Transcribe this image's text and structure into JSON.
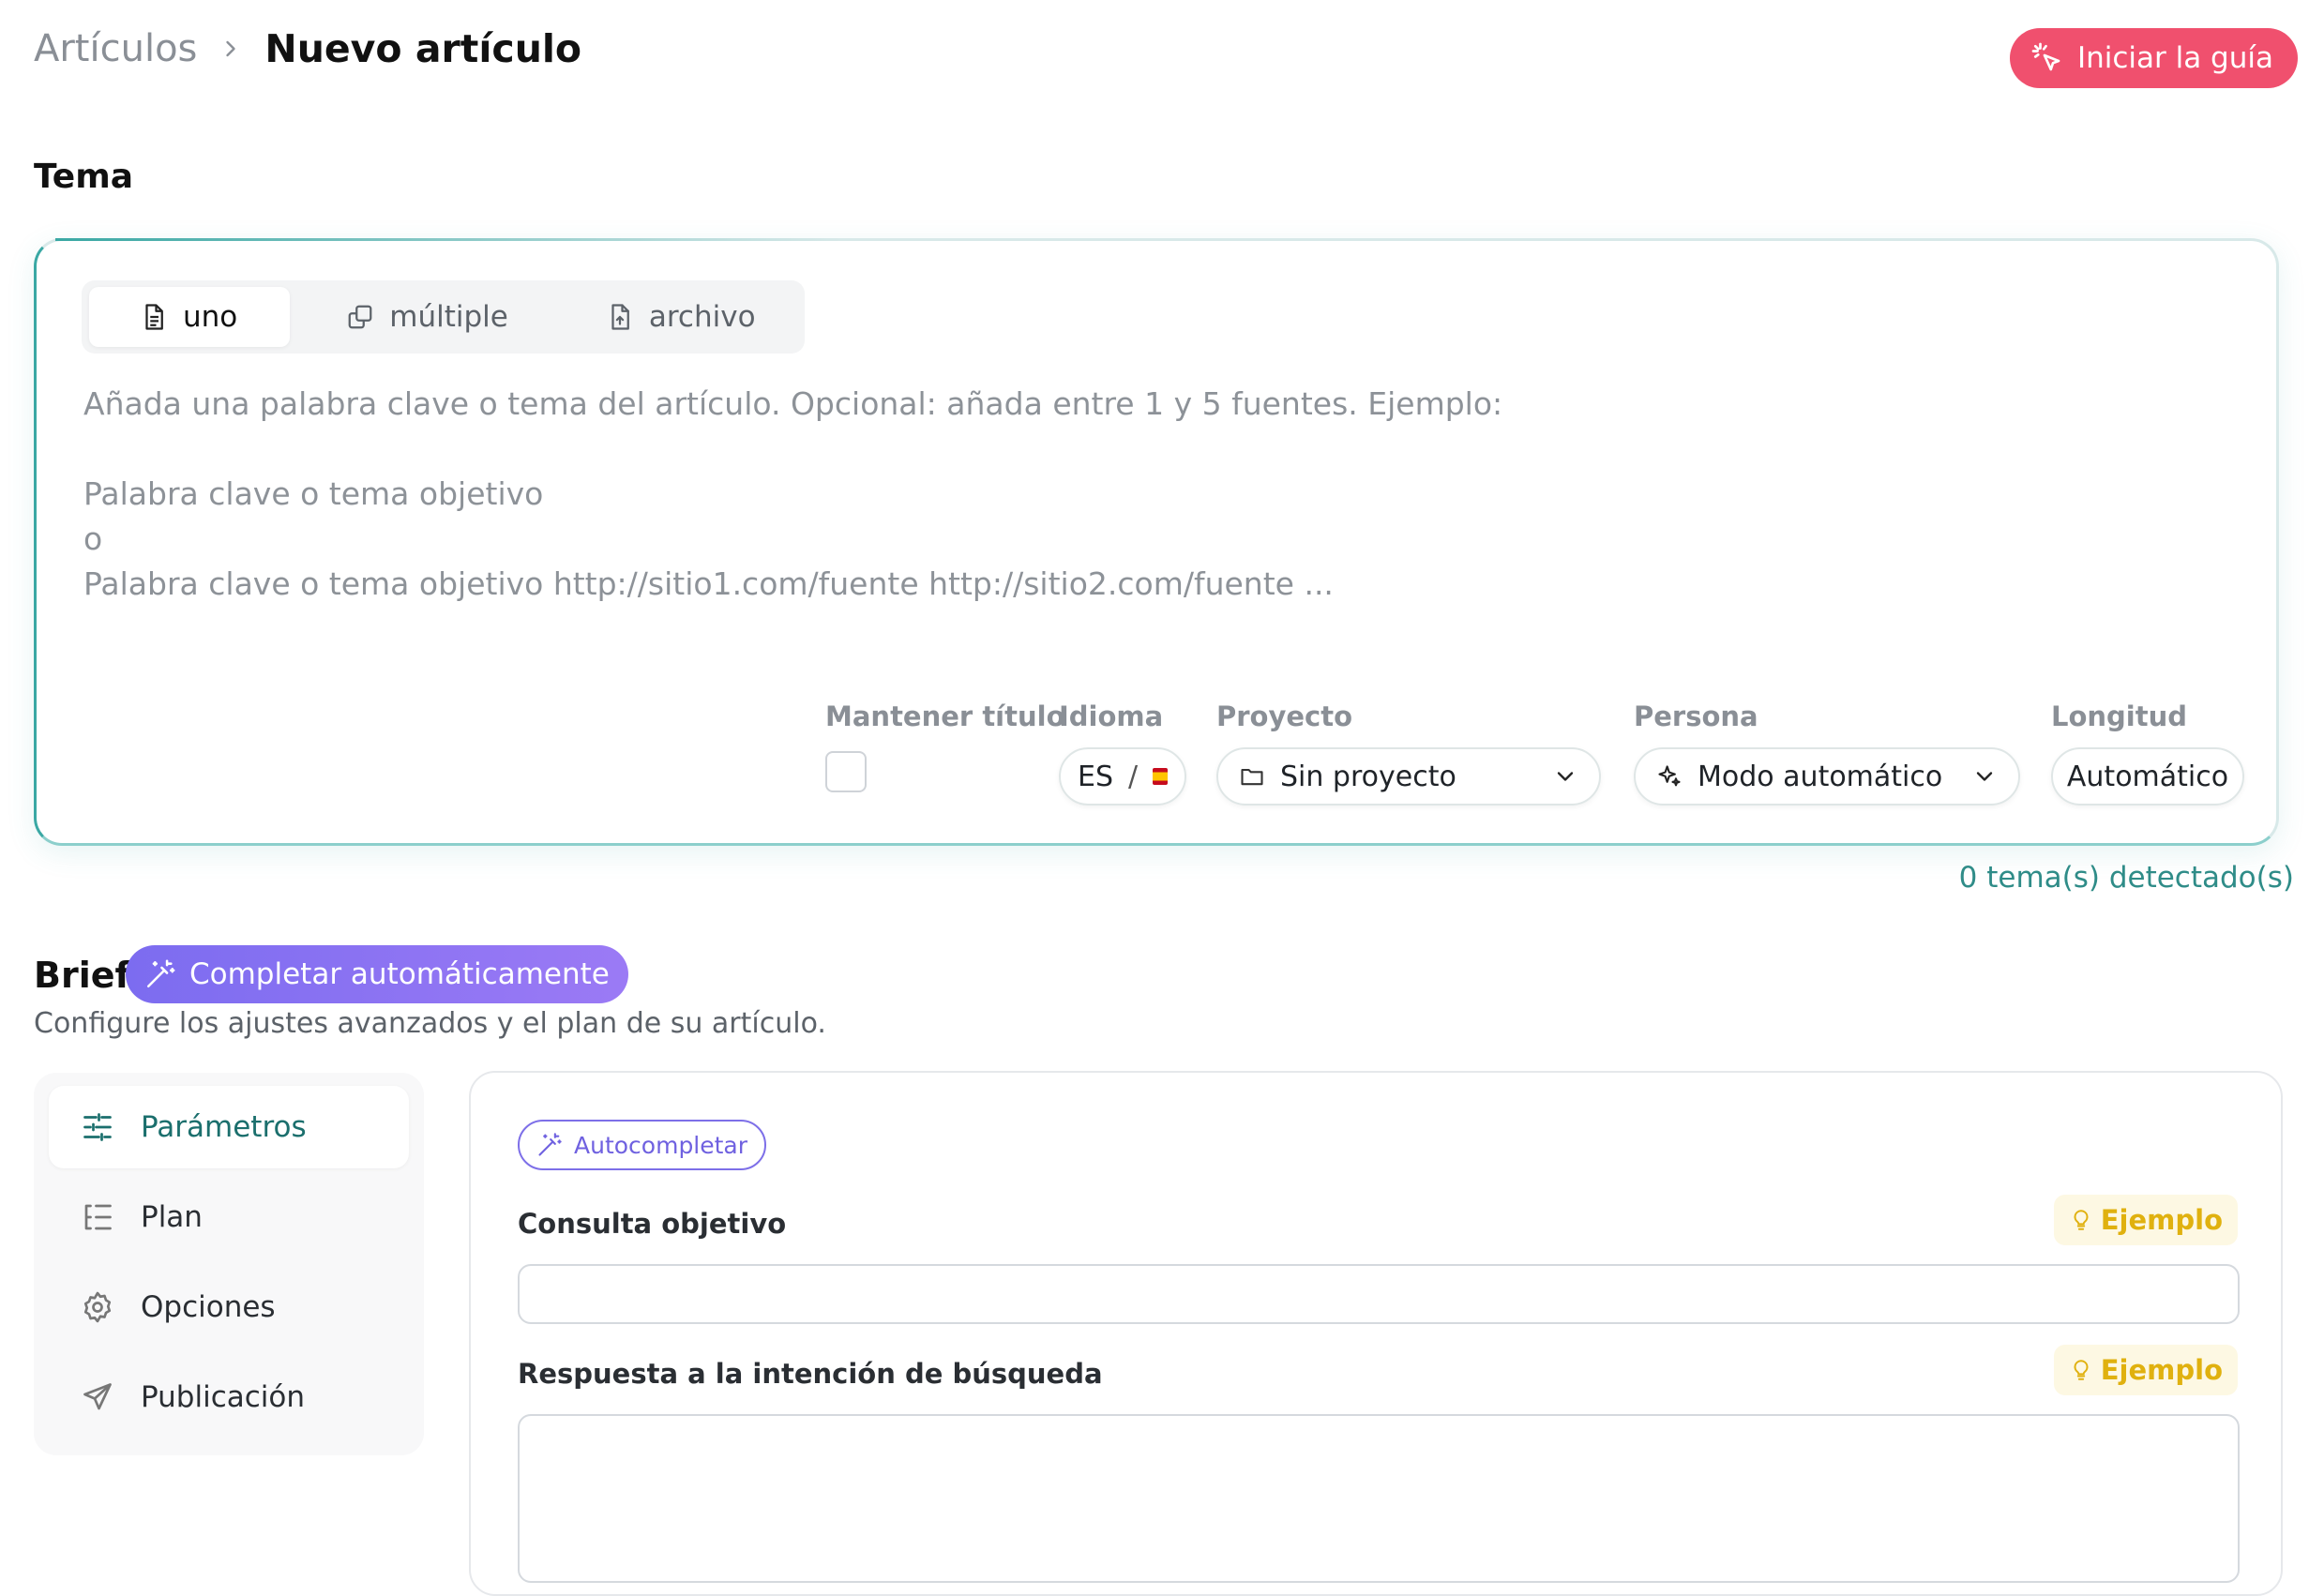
{
  "breadcrumb": {
    "parent": "Artículos",
    "current": "Nuevo artículo"
  },
  "guide_button": {
    "label": "Iniciar la guía"
  },
  "tema": {
    "title": "Tema",
    "tabs": [
      {
        "label": "uno",
        "icon": "file-text-icon",
        "active": true
      },
      {
        "label": "múltiple",
        "icon": "copy-icon",
        "active": false
      },
      {
        "label": "archivo",
        "icon": "file-upload-icon",
        "active": false
      }
    ],
    "placeholder": "Añada una palabra clave o tema del artículo. Opcional: añada entre 1 y 5 fuentes. Ejemplo:\n\nPalabra clave o tema objetivo\no\nPalabra clave o tema objetivo http://sitio1.com/fuente http://sitio2.com/fuente ...",
    "fields": {
      "keep_title_label": "Mantener título",
      "language_label": "Idioma",
      "language_code": "ES",
      "language_sep": "/",
      "project_label": "Proyecto",
      "project_value": "Sin proyecto",
      "persona_label": "Persona",
      "persona_value": "Modo automático",
      "length_label": "Longitud",
      "length_value": "Automático"
    },
    "detected": "0 tema(s) detectado(s)"
  },
  "brief": {
    "title": "Brief",
    "autofill_label": "Completar automáticamente",
    "subtitle": "Configure los ajustes avanzados y el plan de su artículo.",
    "nav": [
      {
        "label": "Parámetros",
        "icon": "sliders-icon",
        "active": true
      },
      {
        "label": "Plan",
        "icon": "outline-list-icon",
        "active": false
      },
      {
        "label": "Opciones",
        "icon": "gear-icon",
        "active": false
      },
      {
        "label": "Publicación",
        "icon": "send-icon",
        "active": false
      }
    ],
    "form": {
      "autocomplete_label": "Autocompletar",
      "target_query_label": "Consulta objetivo",
      "target_query_value": "",
      "intent_label": "Respuesta a la intención de búsqueda",
      "intent_value": "",
      "example_label": "Ejemplo"
    }
  },
  "colors": {
    "accent_teal": "#3aa8a4",
    "guide_red": "#f0506e",
    "purple": "#7c6cf0",
    "example_yellow": "#e0b10f"
  }
}
